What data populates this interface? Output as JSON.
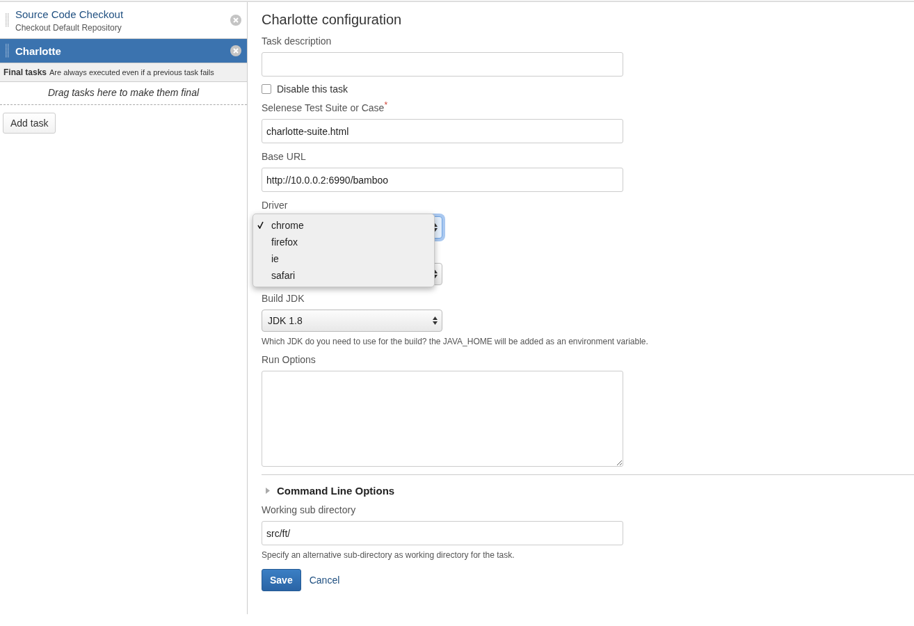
{
  "sidebar": {
    "tasks": [
      {
        "title": "Source Code Checkout",
        "subtitle": "Checkout Default Repository",
        "selected": false
      },
      {
        "title": "Charlotte",
        "selected": true
      }
    ],
    "final_tasks": {
      "title": "Final tasks",
      "description": "Are always executed even if a previous task fails",
      "drop_hint": "Drag tasks here to make them final"
    },
    "add_button": "Add task"
  },
  "form": {
    "title": "Charlotte configuration",
    "fields": [
      {
        "kind": "text",
        "label": "Task description"
      },
      {
        "kind": "checkbox",
        "label": "Disable this task",
        "checked": false
      },
      {
        "kind": "text",
        "label": "Selenese Test Suite or Case",
        "required_mark": "*",
        "value": "charlotte-suite.html"
      },
      {
        "kind": "text",
        "label": "Base URL",
        "value": "http://10.0.0.2:6990/bamboo"
      },
      {
        "kind": "select",
        "label": "Driver",
        "focused": true,
        "menu": [
          {
            "label": "chrome",
            "selected": true
          },
          {
            "label": "firefox",
            "selected": false
          },
          {
            "label": "ie",
            "selected": false
          },
          {
            "label": "safari",
            "selected": false
          }
        ]
      },
      {
        "kind": "select",
        "focused": false
      },
      {
        "kind": "select",
        "label": "Build JDK",
        "value": "JDK 1.8",
        "focused": false,
        "help": "Which JDK do you need to use for the build? the JAVA_HOME will be added as an environment variable."
      },
      {
        "kind": "textarea",
        "label": "Run Options"
      },
      {
        "kind": "section",
        "label": "Command Line Options",
        "expanded": false
      },
      {
        "kind": "text",
        "label": "Working sub directory",
        "value": "src/ft/",
        "help": "Specify an alternative sub-directory as working directory for the task."
      }
    ],
    "save_button": "Save",
    "cancel_link": "Cancel"
  }
}
